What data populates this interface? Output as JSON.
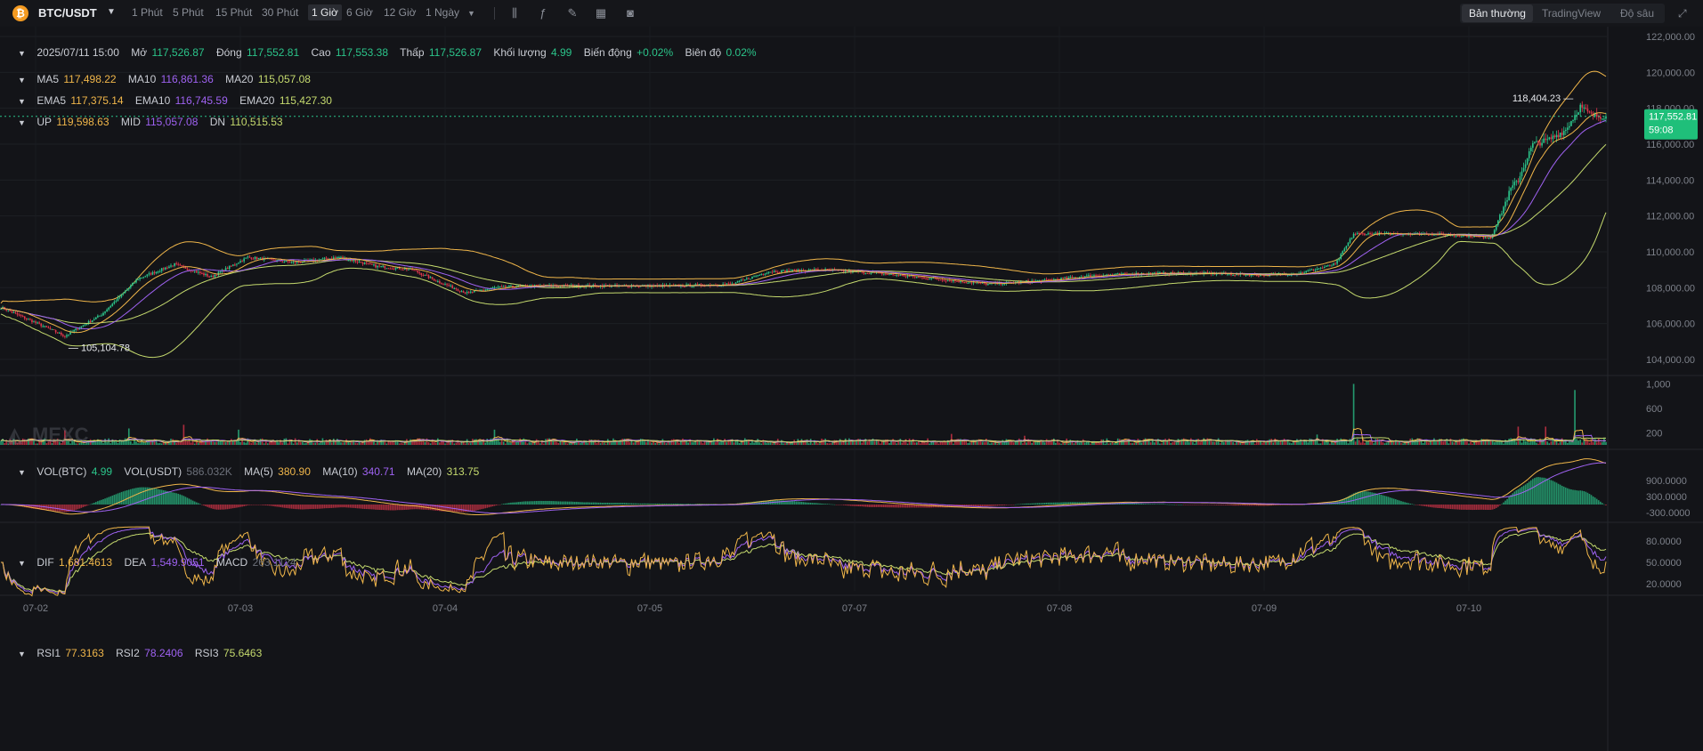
{
  "toolbar": {
    "symbol": "BTC/USDT",
    "intervals": [
      "1 Phút",
      "5 Phút",
      "15 Phút",
      "30 Phút",
      "1 Giờ",
      "6 Giờ",
      "12 Giờ",
      "1 Ngày"
    ],
    "active_interval": "1 Giờ",
    "modes": [
      "Bản thường",
      "TradingView",
      "Độ sâu"
    ],
    "active_mode": "Bản thường"
  },
  "ohlc": {
    "date": "2025/07/11 15:00",
    "open_label": "Mở",
    "open": "117,526.87",
    "close_label": "Đóng",
    "close": "117,552.81",
    "high_label": "Cao",
    "high": "117,553.38",
    "low_label": "Thấp",
    "low": "117,526.87",
    "vol_label": "Khối lượng",
    "vol": "4.99",
    "change_label": "Biến động",
    "change": "+0.02%",
    "amp_label": "Biên độ",
    "amp": "0.02%"
  },
  "ma": {
    "ma5_label": "MA5",
    "ma5": "117,498.22",
    "ma10_label": "MA10",
    "ma10": "116,861.36",
    "ma20_label": "MA20",
    "ma20": "115,057.08"
  },
  "ema": {
    "ema5_label": "EMA5",
    "ema5": "117,375.14",
    "ema10_label": "EMA10",
    "ema10": "116,745.59",
    "ema20_label": "EMA20",
    "ema20": "115,427.30"
  },
  "boll": {
    "up_label": "UP",
    "up": "119,598.63",
    "mid_label": "MID",
    "mid": "115,057.08",
    "dn_label": "DN",
    "dn": "110,515.53"
  },
  "vol": {
    "label": "VOL(BTC)",
    "value": "4.99",
    "usdt_label": "VOL(USDT)",
    "usdt": "586.032K",
    "ma5_label": "MA(5)",
    "ma5": "380.90",
    "ma10_label": "MA(10)",
    "ma10": "340.71",
    "ma20_label": "MA(20)",
    "ma20": "313.75"
  },
  "macd": {
    "dif_label": "DIF",
    "dif": "1,681.4613",
    "dea_label": "DEA",
    "dea": "1,549.9051",
    "macd_label": "MACD",
    "macd": "263.1124"
  },
  "rsi": {
    "rsi1_label": "RSI1",
    "rsi1": "77.3163",
    "rsi2_label": "RSI2",
    "rsi2": "78.2406",
    "rsi3_label": "RSI3",
    "rsi3": "75.6463"
  },
  "price_tag": {
    "price": "117,552.81",
    "countdown": "59:08"
  },
  "annotations": {
    "high": "118,404.23",
    "low": "105,104.78"
  },
  "watermark": "MEXC",
  "colors": {
    "up": "#2bc48a",
    "down": "#e0364b",
    "ma5": "#f0b64a",
    "ma10": "#9f62f2",
    "ma20": "#c5da6e",
    "background": "#131418",
    "tag": "#1fbf7a"
  },
  "chart_data": {
    "type": "candlestick",
    "x_ticks": [
      "07-02",
      "07-03",
      "07-04",
      "07-05",
      "07-07",
      "07-08",
      "07-09",
      "07-10"
    ],
    "price_ticks": [
      "122,000.00",
      "120,000.00",
      "118,000.00",
      "116,000.00",
      "114,000.00",
      "112,000.00",
      "110,000.00",
      "108,000.00",
      "106,000.00",
      "104,000.00"
    ],
    "price_ylim": [
      103500,
      122300
    ],
    "vol_ticks": [
      "1,000",
      "600",
      "200"
    ],
    "vol_ylim": [
      0,
      1050
    ],
    "macd_ticks": [
      "900.0000",
      "300.0000",
      "-300.0000"
    ],
    "macd_ylim": [
      -500,
      1900
    ],
    "rsi_ticks": [
      "80.0000",
      "50.0000",
      "20.0000"
    ],
    "rsi_ylim": [
      10,
      100
    ],
    "close_anchors": [
      [
        0,
        106900
      ],
      [
        20,
        106000
      ],
      [
        35,
        105300
      ],
      [
        55,
        106500
      ],
      [
        75,
        108500
      ],
      [
        95,
        109300
      ],
      [
        115,
        108600
      ],
      [
        135,
        109700
      ],
      [
        160,
        109400
      ],
      [
        185,
        109700
      ],
      [
        205,
        109200
      ],
      [
        225,
        109000
      ],
      [
        240,
        108300
      ],
      [
        255,
        107700
      ],
      [
        270,
        108000
      ],
      [
        290,
        108100
      ],
      [
        330,
        108100
      ],
      [
        370,
        108100
      ],
      [
        400,
        108200
      ],
      [
        420,
        108900
      ],
      [
        450,
        109000
      ],
      [
        480,
        108800
      ],
      [
        510,
        108500
      ],
      [
        540,
        108200
      ],
      [
        570,
        108400
      ],
      [
        600,
        108700
      ],
      [
        630,
        108800
      ],
      [
        660,
        108800
      ],
      [
        690,
        108700
      ],
      [
        710,
        108800
      ],
      [
        730,
        109300
      ],
      [
        740,
        111000
      ],
      [
        750,
        111000
      ],
      [
        780,
        111000
      ],
      [
        800,
        110900
      ],
      [
        815,
        110800
      ],
      [
        820,
        112000
      ],
      [
        826,
        113500
      ],
      [
        830,
        114000
      ],
      [
        838,
        116000
      ],
      [
        846,
        116200
      ],
      [
        856,
        116800
      ],
      [
        864,
        118100
      ],
      [
        870,
        117600
      ],
      [
        878,
        117553
      ]
    ],
    "candle_count": 879,
    "vol_spikes": [
      [
        740,
        1000
      ],
      [
        861,
        900
      ],
      [
        35,
        240
      ],
      [
        70,
        270
      ],
      [
        100,
        330
      ],
      [
        130,
        250
      ],
      [
        270,
        250
      ],
      [
        520,
        180
      ],
      [
        560,
        150
      ],
      [
        720,
        170
      ],
      [
        830,
        300
      ],
      [
        845,
        300
      ]
    ],
    "high_label_index": 864,
    "low_label_index": 35
  }
}
